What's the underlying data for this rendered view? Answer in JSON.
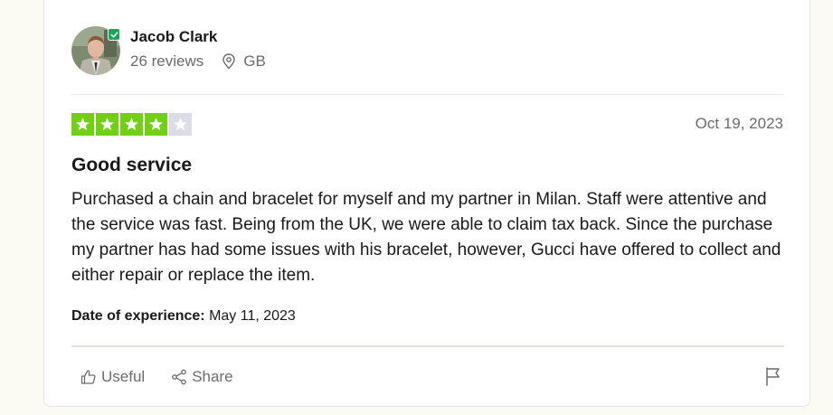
{
  "reviewer": {
    "name": "Jacob Clark",
    "reviews": "26 reviews",
    "country": "GB",
    "verified_icon": "check-icon",
    "avatar_icon": "user-photo"
  },
  "review": {
    "rating": 4,
    "rating_max": 5,
    "date": "Oct 19, 2023",
    "title": "Good service",
    "body": "Purchased a chain and bracelet for myself and my partner in Milan. Staff were attentive and the service was fast. Being from the UK, we were able to claim tax back. Since the purchase my partner has had some issues with his bracelet, however, Gucci have offered to collect and either repair or replace the item.",
    "experience_label": "Date of experience:",
    "experience_date": "May 11, 2023"
  },
  "actions": {
    "useful_label": "Useful",
    "share_label": "Share",
    "useful_icon": "thumbs-up-icon",
    "share_icon": "share-icon",
    "flag_icon": "flag-icon"
  },
  "colors": {
    "star_on": "#73cf11",
    "star_off": "#dcdce6",
    "verified": "#1aa45b",
    "muted_text": "#6b6b6b"
  }
}
